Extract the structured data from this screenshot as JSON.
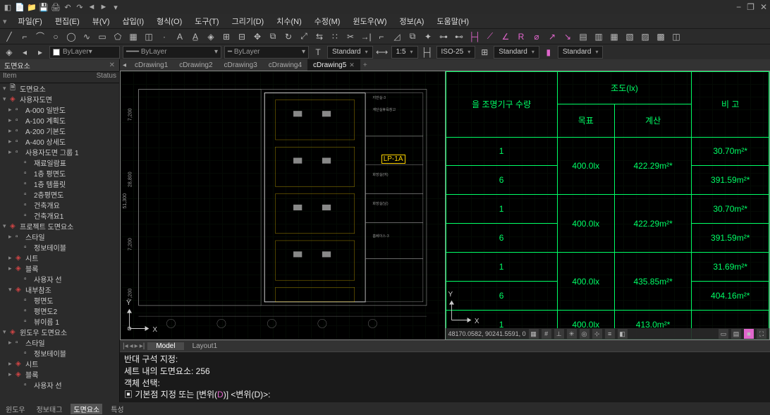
{
  "title_icons": [
    "📄",
    "📁",
    "💾",
    "🖨",
    "↶",
    "↷",
    "◄",
    "►",
    "▾"
  ],
  "window_controls": [
    "−",
    "❐",
    "✕"
  ],
  "menu": [
    {
      "label": "파일(F)"
    },
    {
      "label": "편집(E)"
    },
    {
      "label": "뷰(V)"
    },
    {
      "label": "삽입(I)"
    },
    {
      "label": "형식(O)"
    },
    {
      "label": "도구(T)"
    },
    {
      "label": "그리기(D)"
    },
    {
      "label": "치수(N)"
    },
    {
      "label": "수정(M)"
    },
    {
      "label": "윈도우(W)"
    },
    {
      "label": "정보(A)"
    },
    {
      "label": "도움말(H)"
    }
  ],
  "props": {
    "layer1": "ByLayer",
    "layer2": "ByLayer",
    "layer3": "ByLayer",
    "textstyle": "Standard",
    "dimscale": "1:5",
    "dimstyle": "ISO-25",
    "tablestyle": "Standard",
    "mlstyle": "Standard"
  },
  "sidebar": {
    "title": "도면요소",
    "col1": "Item",
    "col2": "Status",
    "root": "도면요소",
    "items": [
      {
        "label": "사용자도면",
        "lvl": 0,
        "exp": "▾",
        "red": true
      },
      {
        "label": "A-000 일반도",
        "lvl": 1,
        "exp": "▸"
      },
      {
        "label": "A-100 계획도",
        "lvl": 1,
        "exp": "▸"
      },
      {
        "label": "A-200 기본도",
        "lvl": 1,
        "exp": "▸"
      },
      {
        "label": "A-400 상세도",
        "lvl": 1,
        "exp": "▸"
      },
      {
        "label": "사용자도면 그룹 1",
        "lvl": 1,
        "exp": "▸"
      },
      {
        "label": "재료일람표",
        "lvl": 2
      },
      {
        "label": "1층 평면도",
        "lvl": 2
      },
      {
        "label": "1층 템플릿",
        "lvl": 2
      },
      {
        "label": "2층평면도",
        "lvl": 2
      },
      {
        "label": "건축개요",
        "lvl": 2
      },
      {
        "label": "건축개요1",
        "lvl": 2
      },
      {
        "label": "프로젝트 도면요소",
        "lvl": 0,
        "exp": "▾",
        "red": true
      },
      {
        "label": "스타일",
        "lvl": 1,
        "exp": "▸"
      },
      {
        "label": "정보테이블",
        "lvl": 2
      },
      {
        "label": "시트",
        "lvl": 1,
        "exp": "▸",
        "red": true
      },
      {
        "label": "블록",
        "lvl": 1,
        "exp": "▸",
        "red": true
      },
      {
        "label": "사용자 선",
        "lvl": 2
      },
      {
        "label": "내부참조",
        "lvl": 1,
        "exp": "▾",
        "red": true
      },
      {
        "label": "평면도",
        "lvl": 2
      },
      {
        "label": "평면도2",
        "lvl": 2
      },
      {
        "label": "뷰이름 1",
        "lvl": 2
      },
      {
        "label": "윈도우 도면요소",
        "lvl": 0,
        "exp": "▾",
        "red": true
      },
      {
        "label": "스타일",
        "lvl": 1,
        "exp": "▸"
      },
      {
        "label": "정보테이블",
        "lvl": 2
      },
      {
        "label": "시트",
        "lvl": 1,
        "exp": "▸",
        "red": true
      },
      {
        "label": "블록",
        "lvl": 1,
        "exp": "▸",
        "red": true
      },
      {
        "label": "사용자 선",
        "lvl": 2
      }
    ]
  },
  "doc_tabs": [
    {
      "label": "cDrawing1"
    },
    {
      "label": "cDrawing2"
    },
    {
      "label": "cDrawing3"
    },
    {
      "label": "cDrawing4"
    },
    {
      "label": "cDrawing5",
      "active": true
    }
  ],
  "viewport_left": {
    "dims": [
      "7,200",
      "28,800",
      "7,200",
      "51,300",
      "7,200"
    ],
    "lp_tag": "LP-1A",
    "room_labels": [
      "지반실-3",
      "계단실휴육창고",
      "화장실(여)",
      "화장실(남)",
      "홈베이스-3"
    ],
    "ucs_x": "X",
    "ucs_y": "Y"
  },
  "viewport_right": {
    "ucs_x": "X",
    "ucs_y": "Y",
    "header_qty": "을 조명기구 수량",
    "header_lx": "조도(lx)",
    "header_target": "목표",
    "header_calc": "계산",
    "header_remark": "비 고",
    "rows": [
      {
        "n": "1",
        "target": "400.0lx",
        "calc": "422.29m²*",
        "remark": "30.70m²*"
      },
      {
        "n": "6",
        "target": "",
        "calc": "",
        "remark": "391.59m²*"
      },
      {
        "n": "1",
        "target": "400.0lx",
        "calc": "422.29m²*",
        "remark": "30.70m²*"
      },
      {
        "n": "6",
        "target": "",
        "calc": "",
        "remark": "391.59m²*"
      },
      {
        "n": "1",
        "target": "400.0lx",
        "calc": "435.85m²*",
        "remark": "31.69m²*"
      },
      {
        "n": "6",
        "target": "",
        "calc": "",
        "remark": "404.16m²*"
      },
      {
        "n": "1",
        "target": "400.0lx",
        "calc": "413.0m²*",
        "remark": ""
      }
    ],
    "coords": "48170.0582, 90241.5591, 0"
  },
  "model_tabs": {
    "model": "Model",
    "layout1": "Layout1"
  },
  "cmd": {
    "l1": "반대 구석 지정:",
    "l2": "세트 내의 도면요소: 256",
    "l3": "객체 선택:",
    "l4_pre": "기본점 지정 또는 [",
    "l4_br": "변위(",
    "l4_d": "D",
    "l4_br2": ")",
    "l4_post": "] <변위(D)>:"
  },
  "status_tabs": [
    "윈도우",
    "정보태그",
    "도면요소",
    "특성"
  ],
  "status_active": 2
}
